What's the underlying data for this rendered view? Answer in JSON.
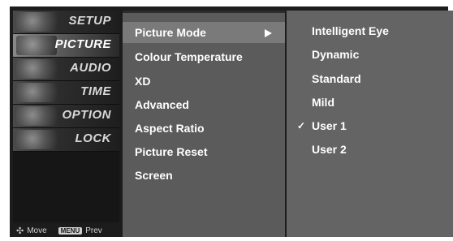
{
  "nav": {
    "items": [
      {
        "label": "SETUP"
      },
      {
        "label": "PICTURE"
      },
      {
        "label": "AUDIO"
      },
      {
        "label": "TIME"
      },
      {
        "label": "OPTION"
      },
      {
        "label": "LOCK"
      }
    ],
    "active": "PICTURE"
  },
  "footer": {
    "move_label": "Move",
    "menu_key_label": "MENU",
    "prev_label": "Prev"
  },
  "menu": {
    "items": [
      {
        "label": "Picture Mode",
        "has_arrow": true
      },
      {
        "label": "Colour Temperature"
      },
      {
        "label": "XD"
      },
      {
        "label": "Advanced"
      },
      {
        "label": "Aspect Ratio"
      },
      {
        "label": "Picture Reset"
      },
      {
        "label": "Screen"
      }
    ],
    "selected": "Picture Mode"
  },
  "submenu": {
    "items": [
      {
        "label": "Intelligent Eye"
      },
      {
        "label": "Dynamic"
      },
      {
        "label": "Standard"
      },
      {
        "label": "Mild"
      },
      {
        "label": "User 1",
        "checked": true
      },
      {
        "label": "User 2"
      }
    ],
    "check_symbol": "✓"
  },
  "colors": {
    "panel_bg": "#1c1c1c",
    "menu_bg": "#5b5b5b",
    "menu_selected_bg": "#7a7a7a",
    "submenu_bg": "#646464",
    "text": "#ffffff"
  }
}
